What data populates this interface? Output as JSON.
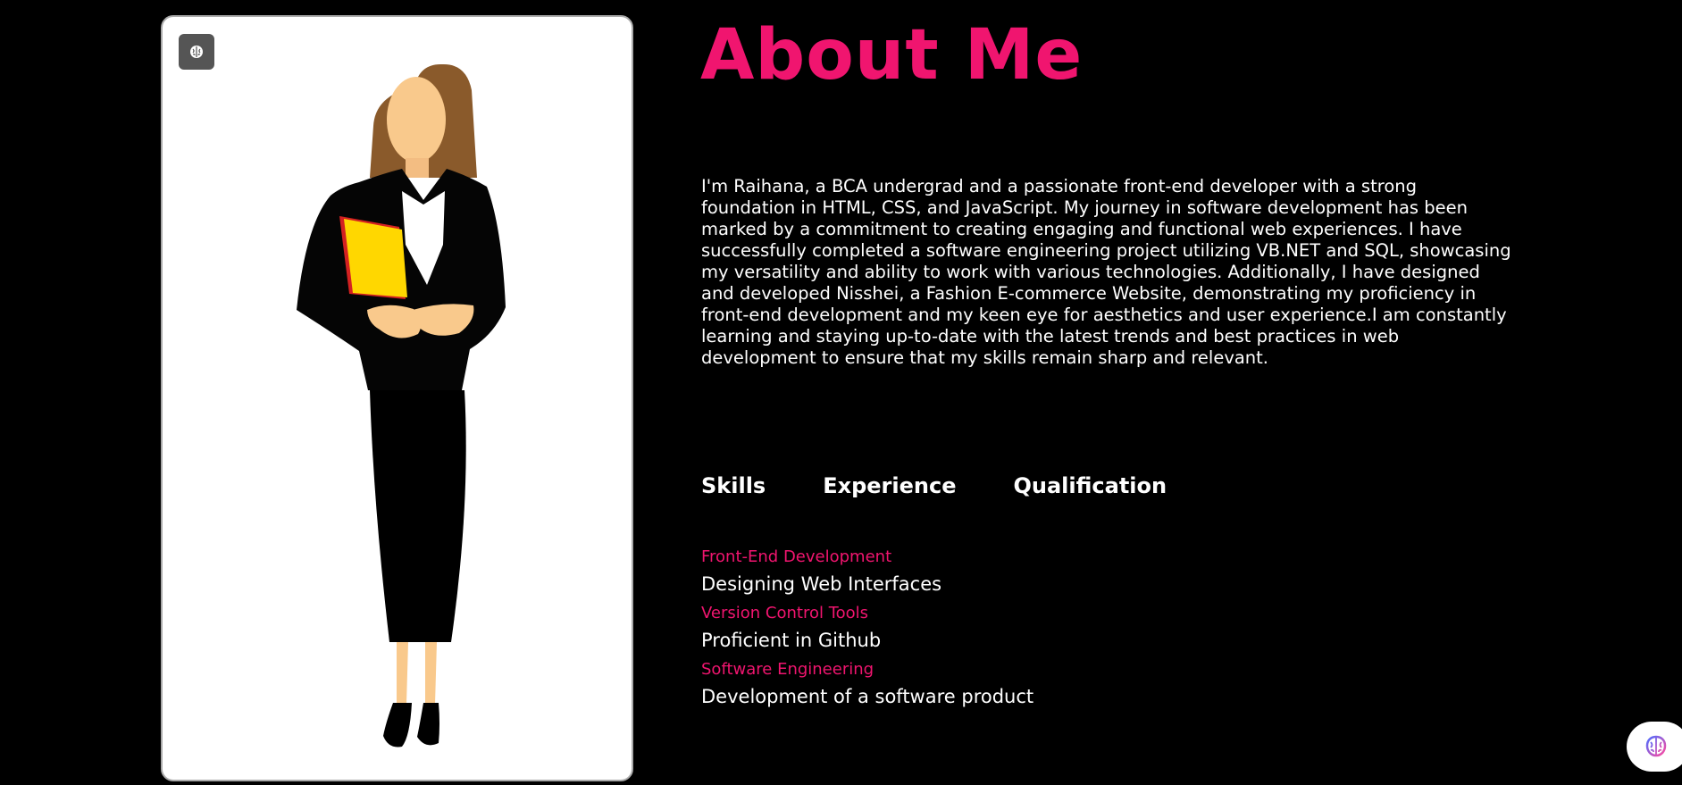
{
  "page": {
    "title": "About Me",
    "bio": "I'm Raihana, a BCA undergrad and a passionate front-end developer with a strong foundation in HTML, CSS, and JavaScript. My journey in software development has been marked by a commitment to creating engaging and functional web experiences. I have successfully completed a software engineering project utilizing VB.NET and SQL, showcasing my versatility and ability to work with various technologies. Additionally, I have designed and developed Nisshei, a Fashion E-commerce Website, demonstrating my proficiency in front-end development and my keen eye for aesthetics and user experience.I am constantly learning and staying up-to-date with the latest trends and best practices in web development to ensure that my skills remain sharp and relevant."
  },
  "tabs": [
    {
      "label": "Skills"
    },
    {
      "label": "Experience"
    },
    {
      "label": "Qualification"
    }
  ],
  "skills": [
    {
      "title": "Front-End Development",
      "desc": "Designing Web Interfaces"
    },
    {
      "title": "Version Control Tools",
      "desc": "Proficient in Github"
    },
    {
      "title": "Software Engineering",
      "desc": "Development of a software product"
    }
  ],
  "icons": {
    "card_badge": "brain-icon",
    "corner_button": "brain-icon"
  },
  "colors": {
    "accent": "#f0156f",
    "background": "#000000",
    "text": "#ffffff"
  }
}
